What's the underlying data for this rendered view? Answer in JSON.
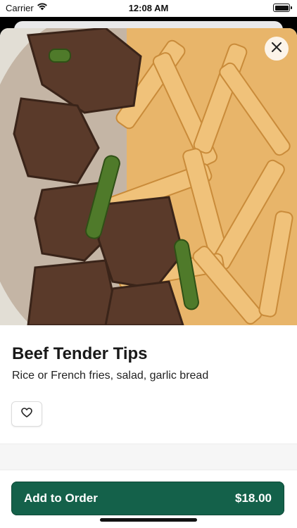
{
  "status_bar": {
    "carrier": "Carrier",
    "time": "12:08 AM"
  },
  "item": {
    "image_icon": "food-photo",
    "title": "Beef Tender Tips",
    "description": "Rice or French fries, salad, garlic bread"
  },
  "actions": {
    "close_icon": "close-icon",
    "favorite_icon": "heart-icon",
    "add_label": "Add to Order",
    "price": "$18.00"
  },
  "colors": {
    "accent": "#14614a"
  }
}
